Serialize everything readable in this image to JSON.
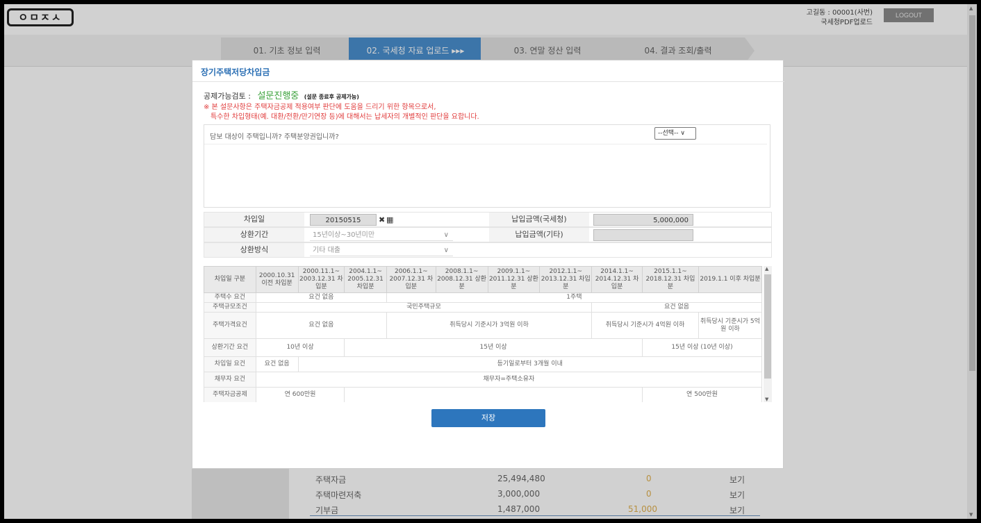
{
  "header": {
    "logo": "ㅇㅁㅈㅅ",
    "user_line1": "고길동 : 00001(사번)",
    "user_line2": "국세청PDF업로드",
    "logout_label": "LOGOUT"
  },
  "steps": [
    {
      "label": "01. 기초 정보 입력",
      "active": false
    },
    {
      "label": "02. 국세청 자료 업로드 ▸▸▸",
      "active": true
    },
    {
      "label": "03. 연말 정산 입력",
      "active": false
    },
    {
      "label": "04. 결과 조회/출력",
      "active": false
    }
  ],
  "background_rows": [
    {
      "name": "주택자금",
      "amount": "25,494,480",
      "deduct": "0",
      "action": "보기"
    },
    {
      "name": "주택마련저축",
      "amount": "3,000,000",
      "deduct": "0",
      "action": "보기"
    },
    {
      "name": "기부금",
      "amount": "1,487,000",
      "deduct": "51,000",
      "action": "보기"
    }
  ],
  "modal": {
    "title": "장기주택저당차입금",
    "check_label": "공제가능검토 :",
    "check_status": "설문진행중",
    "check_note": "(설문 종료후 공제가능)",
    "warn1": "※ 본 설문사항은 주택자금공제 적용여부 판단에 도움을 드리기 위한 항목으로서,",
    "warn2": "특수한 차입형태(예. 대환/전환/만기연장 등)에 대해서는 납세자의 개별적인 판단을 요합니다.",
    "question": "담보 대상이 주택입니까? 주택분양권입니까?",
    "question_select": "--선택-- ∨",
    "form": {
      "loan_date_label": "차입일",
      "loan_date_value": "20150515",
      "clear_icon": "✖",
      "calendar_icon": "▦",
      "paid_nts_label": "납입금액(국세청)",
      "paid_nts_value": "5,000,000",
      "repay_period_label": "상환기간",
      "repay_period_value": "15년이상~30년미만",
      "paid_other_label": "납입금액(기타)",
      "paid_other_value": "",
      "repay_method_label": "상환방식",
      "repay_method_value": "기타 대출",
      "chevron": "∨"
    },
    "rules": {
      "headers": [
        "차입일 구분",
        "2000.10.31 이전 차입분",
        "2000.11.1~ 2003.12.31 차입분",
        "2004.1.1~ 2005.12.31 차입분",
        "2006.1.1~ 2007.12.31 차입분",
        "2008.1.1~ 2008.12.31 상환분",
        "2009.1.1~ 2011.12.31 상환분",
        "2012.1.1~ 2013.12.31 차입분",
        "2014.1.1~ 2014.12.31 차입분",
        "2015.1.1~ 2018.12.31 차입분",
        "2019.1.1 이후 차입분"
      ],
      "r1": {
        "label": "주택수 요건",
        "a": "요건 없음",
        "b": "1주택"
      },
      "r2": {
        "label": "주택규모조건",
        "a": "국민주택규모",
        "b": "요건 없음"
      },
      "r3": {
        "label": "주택가격요건",
        "a": "요건 없음",
        "b": "취득당시 기준시가 3억원 이하",
        "c": "취득당시 기준시가 4억원 이하",
        "d": "취득당시 기준시가 5억원 이하"
      },
      "r4": {
        "label": "상환기간 요건",
        "a": "10년 이상",
        "b": "15년 이상",
        "c": "15년 이상 (10년 이상)"
      },
      "r5": {
        "label": "차입일 요건",
        "a": "요건 없음",
        "b": "등기일로부터 3개월 이내"
      },
      "r6": {
        "label": "채무자 요건",
        "a": "채무자=주택소유자"
      },
      "r7": {
        "label": "주택자금공제",
        "a": "연 600만원",
        "b": "연 500만원"
      }
    },
    "save_label": "저장"
  }
}
